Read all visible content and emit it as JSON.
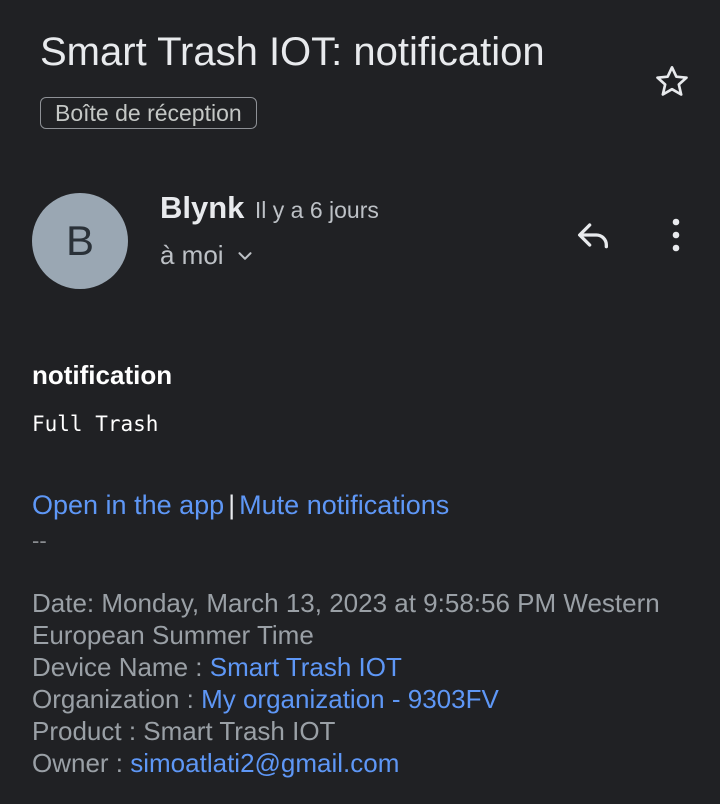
{
  "email": {
    "subject": "Smart Trash IOT: notification",
    "label": "Boîte de réception",
    "sender": {
      "initial": "B",
      "name": "Blynk",
      "time": "Il y a 6 jours",
      "recipient": "à moi"
    },
    "icons": {
      "star": "star-outline-icon",
      "reply": "reply-icon",
      "more": "more-vert-icon",
      "expand": "chevron-down-icon"
    },
    "body": {
      "heading": "notification",
      "message": "Full Trash",
      "open_app_link": "Open in the app",
      "separator": "|",
      "mute_link": "Mute notifications",
      "signature_dash": "--",
      "date_line": "Date: Monday, March 13, 2023 at 9:58:56 PM Western European Summer Time",
      "device_label": "Device Name : ",
      "device_value": "Smart Trash IOT",
      "org_label": "Organization : ",
      "org_value": "My organization - 9303FV",
      "product_line": "Product : Smart Trash IOT",
      "owner_label": "Owner : ",
      "owner_value": "simoatlati2@gmail.com"
    }
  },
  "colors": {
    "background": "#202124",
    "link": "#5e97f6",
    "avatar": "#9aa7b3",
    "muted_text": "#9aa0a6"
  }
}
